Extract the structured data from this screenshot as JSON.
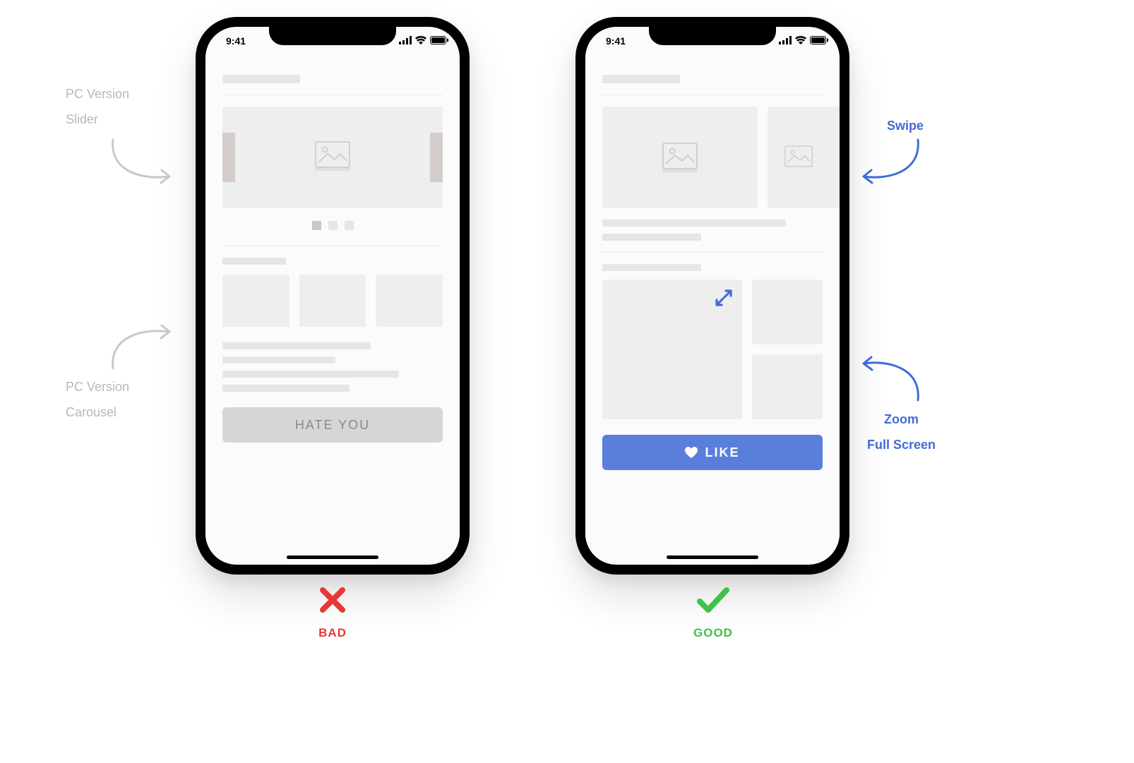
{
  "status_bar": {
    "time": "9:41"
  },
  "phones": {
    "bad": {
      "button_label": "HATE YOU"
    },
    "good": {
      "button_label": "LIKE",
      "button_icon": "heart-icon"
    }
  },
  "annotations": {
    "left_top": "PC Version\nSlider",
    "left_bottom": "PC Version\nCarousel",
    "right_top": "Swipe",
    "right_bottom": "Zoom\nFull Screen"
  },
  "verdict": {
    "bad": {
      "icon": "cross-icon",
      "label": "BAD"
    },
    "good": {
      "icon": "check-icon",
      "label": "GOOD"
    }
  },
  "colors": {
    "blue": "#5a7edc",
    "red": "#e53935",
    "green": "#3fc14a",
    "grey_annot": "#b8b8b8"
  }
}
